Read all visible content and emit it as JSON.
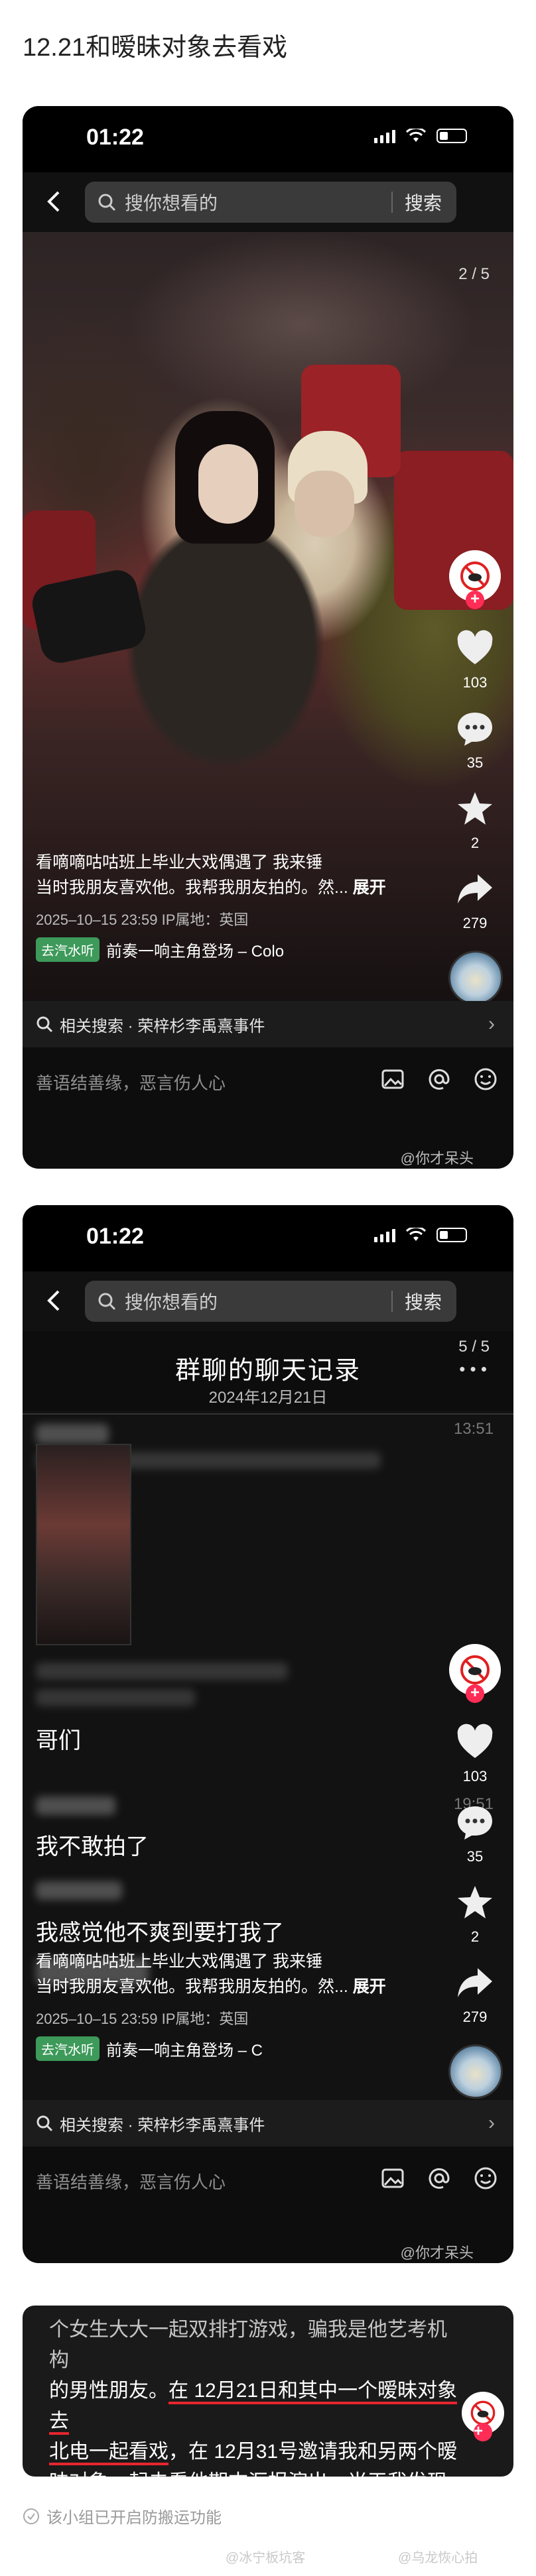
{
  "post": {
    "title": "12.21和暧昧对象去看戏",
    "auto_note": "该小组已开启防搬运功能",
    "bottom_watermark_left": "@冰宁板坑客",
    "bottom_watermark_right": "@乌龙恢心拍"
  },
  "screens": [
    {
      "time": "01:22",
      "search_placeholder": "搜你想看的",
      "search_button": "搜索",
      "page_counter": "2 / 5",
      "likes": "103",
      "comments": "35",
      "favorites": "2",
      "shares": "279",
      "caption_line1": "看嘀嘀咕咕班上毕业大戏偶遇了 我来锤",
      "caption_line2": "当时我朋友喜欢他。我帮我朋友拍的。然...",
      "caption_more": "展开",
      "meta": "2025–10–15 23:59 IP属地：英国",
      "music_tag": "去汽水听",
      "music_name": "前奏一响主角登场 – Colo",
      "related": "相关搜索 · 荣梓杉李禹熹事件",
      "comment_placeholder": "善语结善缘，恶言伤人心",
      "watermark": "@你才呆头"
    },
    {
      "time": "01:22",
      "search_placeholder": "搜你想看的",
      "search_button": "搜索",
      "page_counter": "5 / 5",
      "chat_title": "群聊的聊天记录",
      "chat_date": "2024年12月21日",
      "chat_time_1": "13:51",
      "chat_time_2": "19:51",
      "msg1": "哥们",
      "msg2": "我不敢拍了",
      "msg3": "我感觉他不爽到要打我了",
      "likes": "103",
      "comments": "35",
      "favorites": "2",
      "shares": "279",
      "caption_line1": "看嘀嘀咕咕班上毕业大戏偶遇了 我来锤",
      "caption_line2": "当时我朋友喜欢他。我帮我朋友拍的。然...",
      "caption_more": "展开",
      "meta": "2025–10–15 23:59 IP属地：英国",
      "music_tag": "去汽水听",
      "music_name": "前奏一响主角登场 – C",
      "related": "相关搜索 · 荣梓杉李禹熹事件",
      "comment_placeholder": "善语结善缘，恶言伤人心",
      "watermark": "@你才呆头"
    }
  ],
  "text_screen": {
    "line1": "个女生大大一起双排打游戏，骗我是他艺考机构",
    "line2_a": "的男性朋友。",
    "line2_b": "在 12月21日和其中一个暧昧对象去",
    "line3_a": "北电一起看戏",
    "line3_b": "，在 12月31号邀请我和另两个暧",
    "line4": "昧对象一起去看他期末汇报演出，当天我发现"
  },
  "colors": {
    "like_red": "#ff2c55",
    "music_green": "#3d9a5a",
    "underline_red": "#e8252e"
  }
}
